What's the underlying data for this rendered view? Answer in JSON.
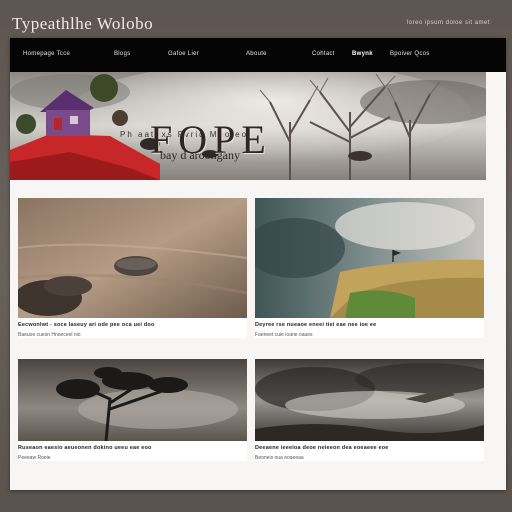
{
  "site": {
    "title": "Typeathlhe Wolobo",
    "tagline": "loreo ipsum doloe sit amet"
  },
  "nav": {
    "items": [
      {
        "label": "Homepage  Tcce"
      },
      {
        "label": "Blogs"
      },
      {
        "label": "Gafoe  Lier"
      },
      {
        "label": "Aboute"
      },
      {
        "label": "Cohtact"
      },
      {
        "label": "Bwynk"
      },
      {
        "label": "Bpoiver  Qcos"
      }
    ]
  },
  "hero": {
    "top_text": "Ph aatnxs  Fvrid Meoleoi",
    "banner": "FOPE",
    "subtitle": "bay d  aroongany"
  },
  "cards": [
    {
      "caption": "Eecwonlwt  - soce laseuy ari ode pee oca uei doo",
      "subcaption": "Baeuoe cuesn  Hnoeceel nio"
    },
    {
      "caption": "Deyree rse nueaoe eneei tiei eae nee ioe ee",
      "subcaption": "Faeneet cuie  ioane oaues"
    },
    {
      "caption": "Ruseaon  eaesio aeueonen dokino ueeu eae eoo",
      "subcaption": "Peeeaw  Roeie"
    },
    {
      "caption": "Deeaene ieeeioa deoe neieeon dea eoeaeee eoe",
      "subcaption": "Beoneis oua eoaeeaa"
    }
  ]
}
